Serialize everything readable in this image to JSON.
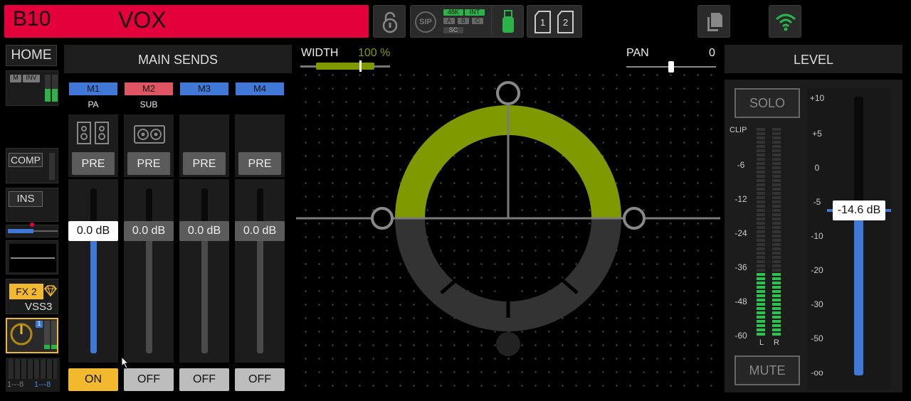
{
  "channel": {
    "id": "B10",
    "name": "VOX",
    "color": "#e4003b"
  },
  "toolbar": {
    "sip_label": "SIP",
    "clock_tags": [
      "48K",
      "INT",
      "A",
      "B",
      "C",
      "SC"
    ],
    "sd_slots": [
      "1",
      "2"
    ]
  },
  "strip": {
    "home_label": "HOME",
    "input_badges": [
      "M",
      "INV"
    ],
    "comp_label": "COMP",
    "ins_label": "INS",
    "fx_label": "FX 2",
    "fx_name": "VSS3",
    "fx_num": "1",
    "bank_left": "1---8",
    "bank_right": "1---8"
  },
  "sends": {
    "title": "MAIN SENDS",
    "pre_label": "PRE",
    "items": [
      {
        "tab": "M1",
        "name": "PA",
        "color": "#3f78d6",
        "db": "0.0 dB",
        "state": "ON",
        "level": 0.73,
        "active": true,
        "icon": "speakers-icon"
      },
      {
        "tab": "M2",
        "name": "SUB",
        "color": "#e05563",
        "db": "0.0 dB",
        "state": "OFF",
        "level": 0.73,
        "active": false,
        "icon": "subwoofer-icon"
      },
      {
        "tab": "M3",
        "name": "",
        "color": "#3f78d6",
        "db": "0.0 dB",
        "state": "OFF",
        "level": 0.73,
        "active": false,
        "icon": ""
      },
      {
        "tab": "M4",
        "name": "",
        "color": "#3f78d6",
        "db": "0.0 dB",
        "state": "OFF",
        "level": 0.73,
        "active": false,
        "icon": ""
      }
    ]
  },
  "panner": {
    "width_label": "WIDTH",
    "width_value": "100 %",
    "width_fraction": 1.0,
    "pan_label": "PAN",
    "pan_value": "0",
    "pan_fraction": 0.5,
    "arc_color": "#7f9a00"
  },
  "level": {
    "title": "LEVEL",
    "solo_label": "SOLO",
    "mute_label": "MUTE",
    "clip_label": "CLIP",
    "meter_scale": [
      "-6",
      "-12",
      "-24",
      "-36",
      "-48",
      "-60"
    ],
    "meter_channels": [
      "L",
      "R"
    ],
    "meter_fraction": 0.3,
    "fader_scale": [
      "+10",
      "+5",
      "0",
      "-5",
      "-10",
      "-20",
      "-30",
      "-50",
      "-oo"
    ],
    "fader_value": "-14.6 dB",
    "fader_fraction": 0.56,
    "fader_color": "#3f78d6"
  }
}
